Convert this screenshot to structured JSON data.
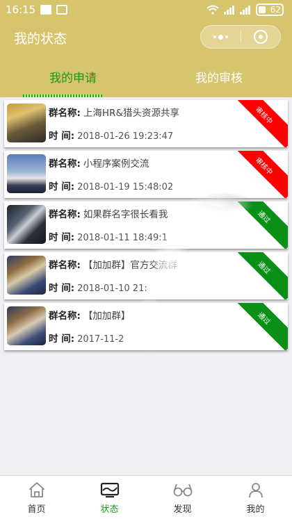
{
  "status_bar": {
    "time": "16:15",
    "battery": "62"
  },
  "header": {
    "title": "我的状态",
    "menu_icon": "more-dots-icon",
    "close_icon": "target-circle-icon"
  },
  "tabs": [
    {
      "label": "我的申请",
      "active": true
    },
    {
      "label": "我的审核",
      "active": false
    }
  ],
  "labels": {
    "group_name": "群名称:",
    "time": "时  间:"
  },
  "cards": [
    {
      "group": "上海HR&猎头资源共享",
      "time": "2018-01-26 19:23:47",
      "status": "审核中",
      "status_type": "review"
    },
    {
      "group": "小程序案例交流",
      "time": "2018-01-19 15:48:02",
      "status": "审核中",
      "status_type": "review"
    },
    {
      "group": "如果群名字很长看我",
      "time": "2018-01-11 18:49:1",
      "status": "通过",
      "status_type": "passed"
    },
    {
      "group": "【加加群】官方交流群",
      "time": "2018-01-10 21:",
      "status": "通过",
      "status_type": "passed"
    },
    {
      "group": "【加加群】",
      "time": "2017-11-2",
      "status": "通过",
      "status_type": "passed"
    }
  ],
  "tabbar": [
    {
      "label": "首页",
      "icon": "home-icon",
      "active": false
    },
    {
      "label": "状态",
      "icon": "monitor-icon",
      "active": true
    },
    {
      "label": "发现",
      "icon": "glasses-icon",
      "active": false
    },
    {
      "label": "我的",
      "icon": "user-icon",
      "active": false
    }
  ],
  "colors": {
    "theme": "#d7c56e",
    "accent": "#1a9a1a",
    "review_badge": "#fe0000",
    "passed_badge": "#0a8f17"
  }
}
